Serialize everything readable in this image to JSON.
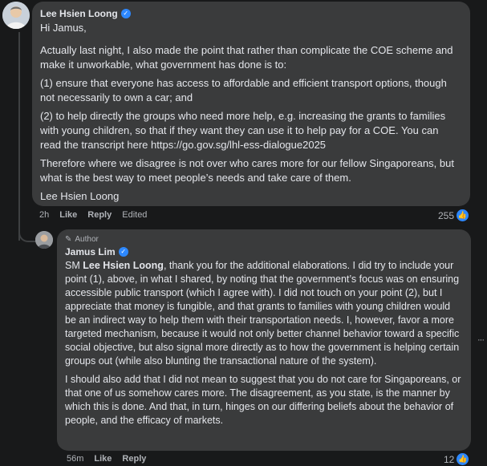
{
  "comment1": {
    "author": "Lee Hsien Loong",
    "greeting": "Hi Jamus,",
    "paragraphs": [
      "Actually last night, I also made the point that rather than complicate the COE scheme and make it unworkable, what government has done is to:",
      "(1) ensure that everyone has access to affordable and efficient transport options, though not necessarily to own a car; and",
      "(2) to help directly the groups who need more help, e.g. increasing the grants to families with young children, so that if they want they can use it to help pay for a COE. You can read the transcript here https://go.gov.sg/lhl-ess-dialogue2025",
      "Therefore where we disagree is not over who cares more for our fellow Singaporeans, but what is the best way to meet people’s needs and take care of them."
    ],
    "signature": "Lee Hsien Loong",
    "time": "2h",
    "like_label": "Like",
    "reply_label": "Reply",
    "edited_label": "Edited",
    "reaction_count": "255"
  },
  "comment2": {
    "author_badge": "Author",
    "author": "Jamus Lim",
    "mention": "Lee Hsien Loong",
    "prefix": "SM",
    "p1_rest": ", thank you for the additional elaborations. I did try to include your point (1), above, in what I shared, by noting that the government’s focus was on ensuring accessible public transport (which I agree with). I did not touch on your point (2), but I appreciate that money is fungible, and that grants to families with young children would be an indirect way to help them with their transportation needs. I, however, favor a more targeted mechanism, because it would not only better channel behavior toward a specific social objective, but also signal more directly as to how the government is helping certain groups out (while also blunting the transactional nature of the system).",
    "p2": "I should also add that I did not mean to suggest that you do not care for Singaporeans, or that one of us somehow cares more. The disagreement, as you state, is the manner by which this is done. And that, in turn, hinges on our differing beliefs about the behavior of people, and the efficacy of markets.",
    "time": "56m",
    "like_label": "Like",
    "reply_label": "Reply",
    "reaction_count": "12"
  },
  "colors": {
    "background": "#18191a",
    "bubble": "#3a3b3c",
    "text": "#e4e6eb",
    "muted": "#b0b3b8",
    "accent": "#2d88ff"
  },
  "icons": {
    "verified": "verified-badge-icon",
    "like": "like-thumb-icon",
    "author": "pen-icon",
    "more": "more-options-icon"
  }
}
